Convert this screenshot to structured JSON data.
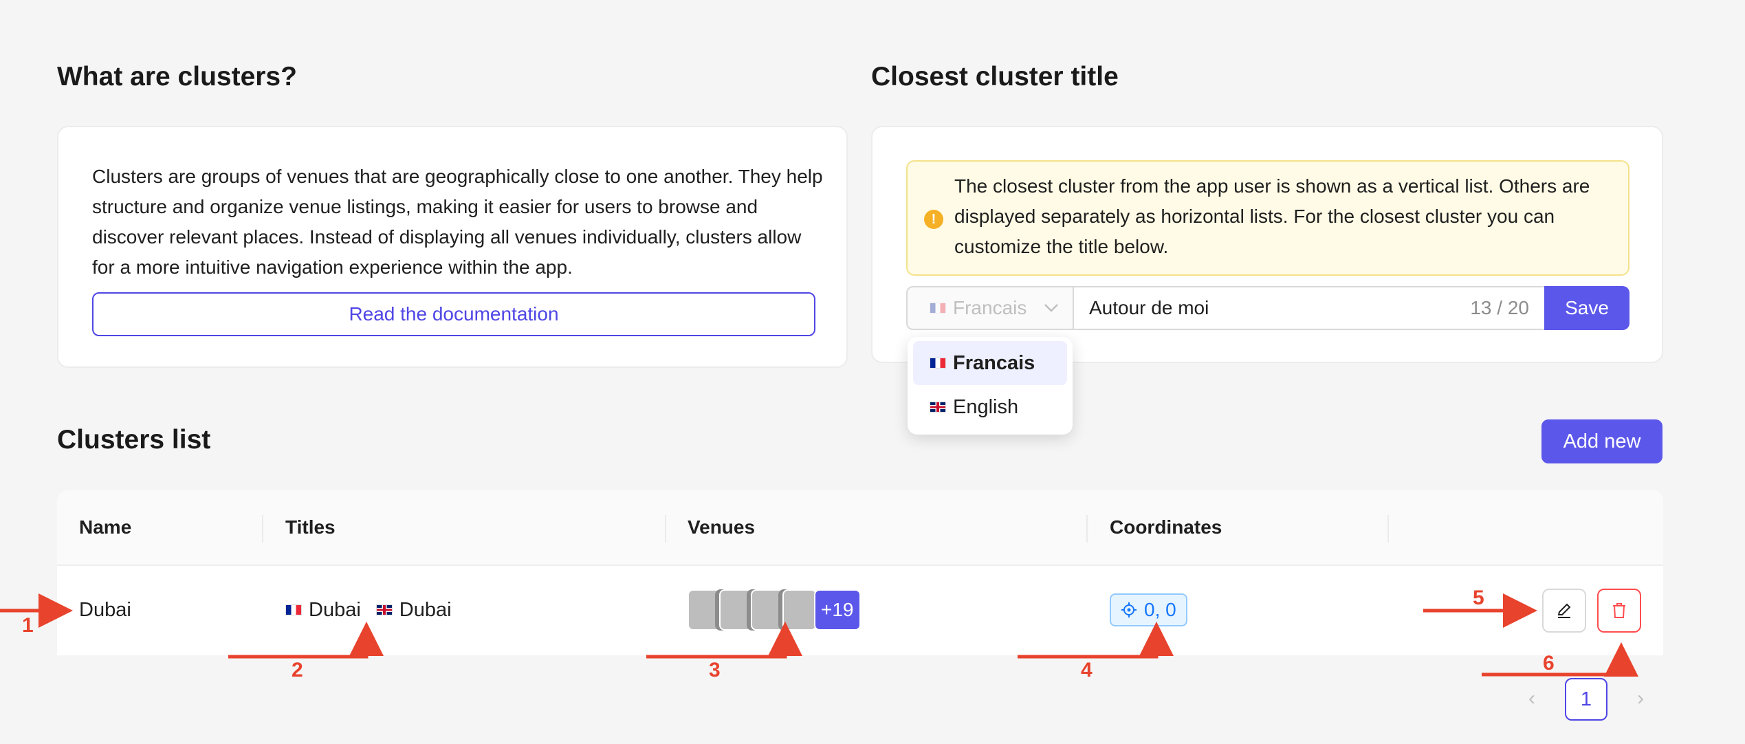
{
  "about": {
    "title": "What are clusters?",
    "description": "Clusters are groups of venues that are geographically close to one another. They help structure and organize venue listings, making it easier for users to browse and discover relevant places. Instead of displaying all venues individually, clusters allow for a more intuitive navigation experience within the app.",
    "doc_button": "Read the documentation"
  },
  "closest": {
    "title": "Closest cluster title",
    "alert": "The closest cluster from the app user is shown as a vertical list. Others are displayed separately as horizontal lists. For the closest cluster you can customize the title below.",
    "language_selected": "Francais",
    "input_value": "Autour de moi",
    "char_count": "13 / 20",
    "save_label": "Save",
    "dropdown_options": [
      "Francais",
      "English"
    ]
  },
  "clusters": {
    "title": "Clusters list",
    "add_button": "Add new",
    "columns": [
      "Name",
      "Titles",
      "Venues",
      "Coordinates"
    ],
    "rows": [
      {
        "name": "Dubai",
        "titles": [
          {
            "lang": "fr",
            "text": "Dubai"
          },
          {
            "lang": "en",
            "text": "Dubai"
          }
        ],
        "venues_more": "+19",
        "coordinates": "0, 0"
      }
    ]
  },
  "pagination": {
    "current_page": "1"
  },
  "annotations": [
    "1",
    "2",
    "3",
    "4",
    "5",
    "6"
  ],
  "colors": {
    "accent": "#5b57ea",
    "annotation": "#e8432d",
    "danger": "#ff4d4f",
    "alert_bg": "#fffbe6"
  }
}
